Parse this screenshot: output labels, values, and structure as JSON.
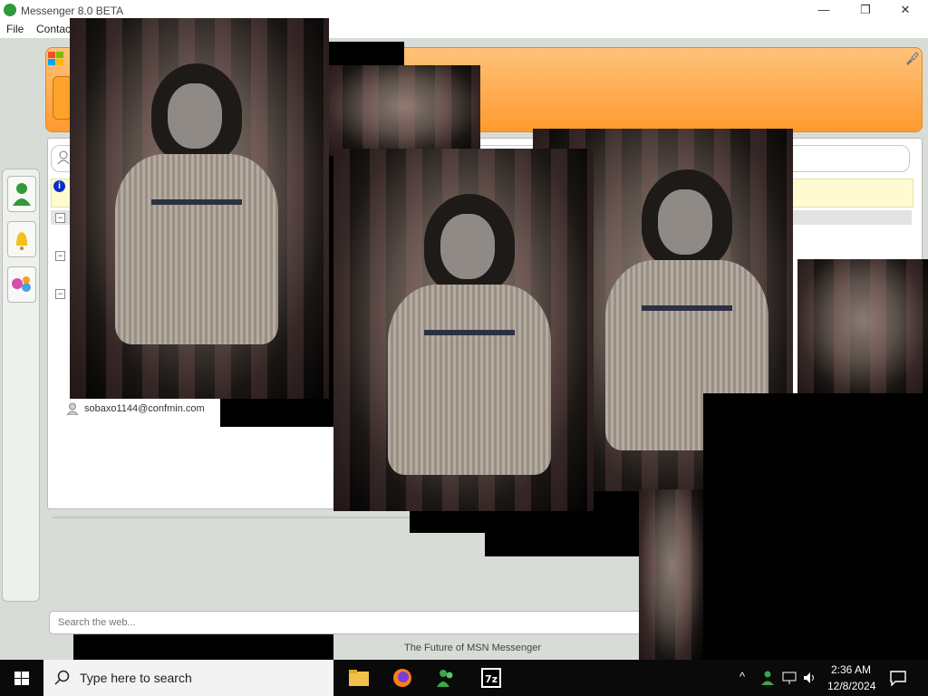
{
  "window": {
    "title": "Messenger 8.0 BETA",
    "min_glyph": "—",
    "restore_glyph": "❐",
    "close_glyph": "✕"
  },
  "menu": {
    "file": "File",
    "contacts": "Contac"
  },
  "contacts": {
    "email": "sobaxo1144@confmin.com",
    "collapse_glyph": "−"
  },
  "info": {
    "glyph": "i"
  },
  "web_search": {
    "placeholder": "Search the web..."
  },
  "footer": {
    "text": "The Future of MSN Messenger"
  },
  "taskbar": {
    "search_placeholder": "Type here to search",
    "time": "2:36 AM",
    "date": "12/8/2024",
    "chevron": "^"
  },
  "colors": {
    "header_orange": "#ff9a2e",
    "info_bar": "#fffbd0",
    "taskbar": "#0a0a0a"
  }
}
